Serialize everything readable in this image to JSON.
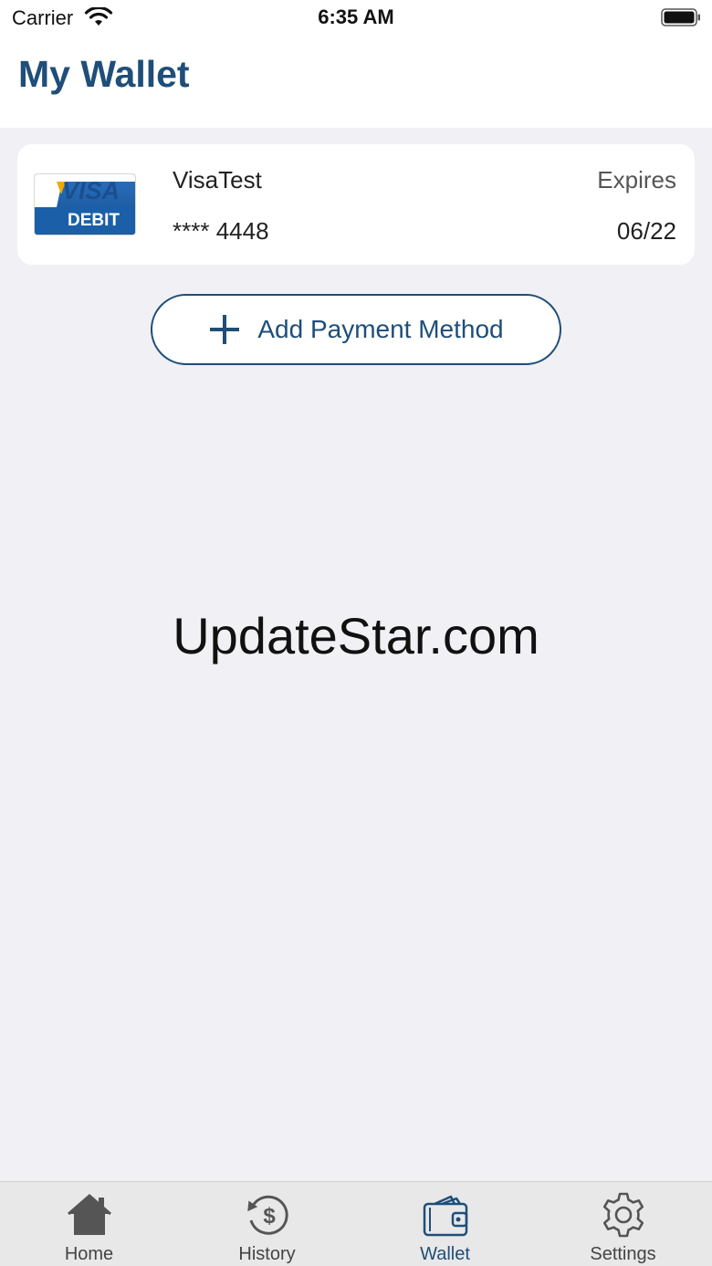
{
  "status_bar": {
    "carrier": "Carrier",
    "time": "6:35 AM"
  },
  "header": {
    "title": "My Wallet"
  },
  "card": {
    "logo_text_top": "VISA",
    "logo_text_bottom": "DEBIT",
    "name": "VisaTest",
    "masked_number": "**** 4448",
    "expires_label": "Expires",
    "expiry": "06/22"
  },
  "add_payment": {
    "label": "Add Payment Method"
  },
  "watermark": "UpdateStar.com",
  "tabs": [
    {
      "label": "Home",
      "icon": "home-icon",
      "active": false
    },
    {
      "label": "History",
      "icon": "history-icon",
      "active": false
    },
    {
      "label": "Wallet",
      "icon": "wallet-icon",
      "active": true
    },
    {
      "label": "Settings",
      "icon": "gear-icon",
      "active": false
    }
  ],
  "colors": {
    "brand": "#1f4e79",
    "background": "#f0f0f5",
    "visa_blue": "#1a5fa8",
    "visa_gold": "#f2a900"
  }
}
